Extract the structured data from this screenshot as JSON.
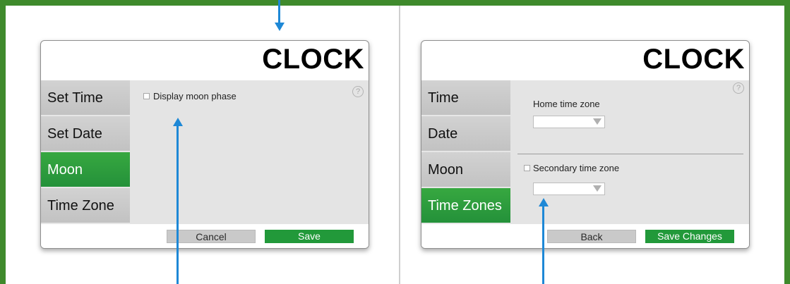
{
  "left": {
    "title": "CLOCK",
    "nav": [
      "Set Time",
      "Set Date",
      "Moon",
      "Time Zone"
    ],
    "active_index": 2,
    "checkbox_label": "Display moon phase",
    "help": "?",
    "cancel_label": "Cancel",
    "save_label": "Save"
  },
  "right": {
    "title": "CLOCK",
    "nav": [
      "Time",
      "Date",
      "Moon",
      "Time Zones"
    ],
    "active_index": 3,
    "home_label": "Home time zone",
    "secondary_label": "Secondary time zone",
    "help": "?",
    "back_label": "Back",
    "save_label": "Save Changes"
  },
  "colors": {
    "frame_green": "#3f8a2c",
    "active_green": "#24913a",
    "arrow_blue": "#1e88d6"
  },
  "icons": [
    "help-icon",
    "dropdown-caret-icon",
    "arrow-icon"
  ]
}
